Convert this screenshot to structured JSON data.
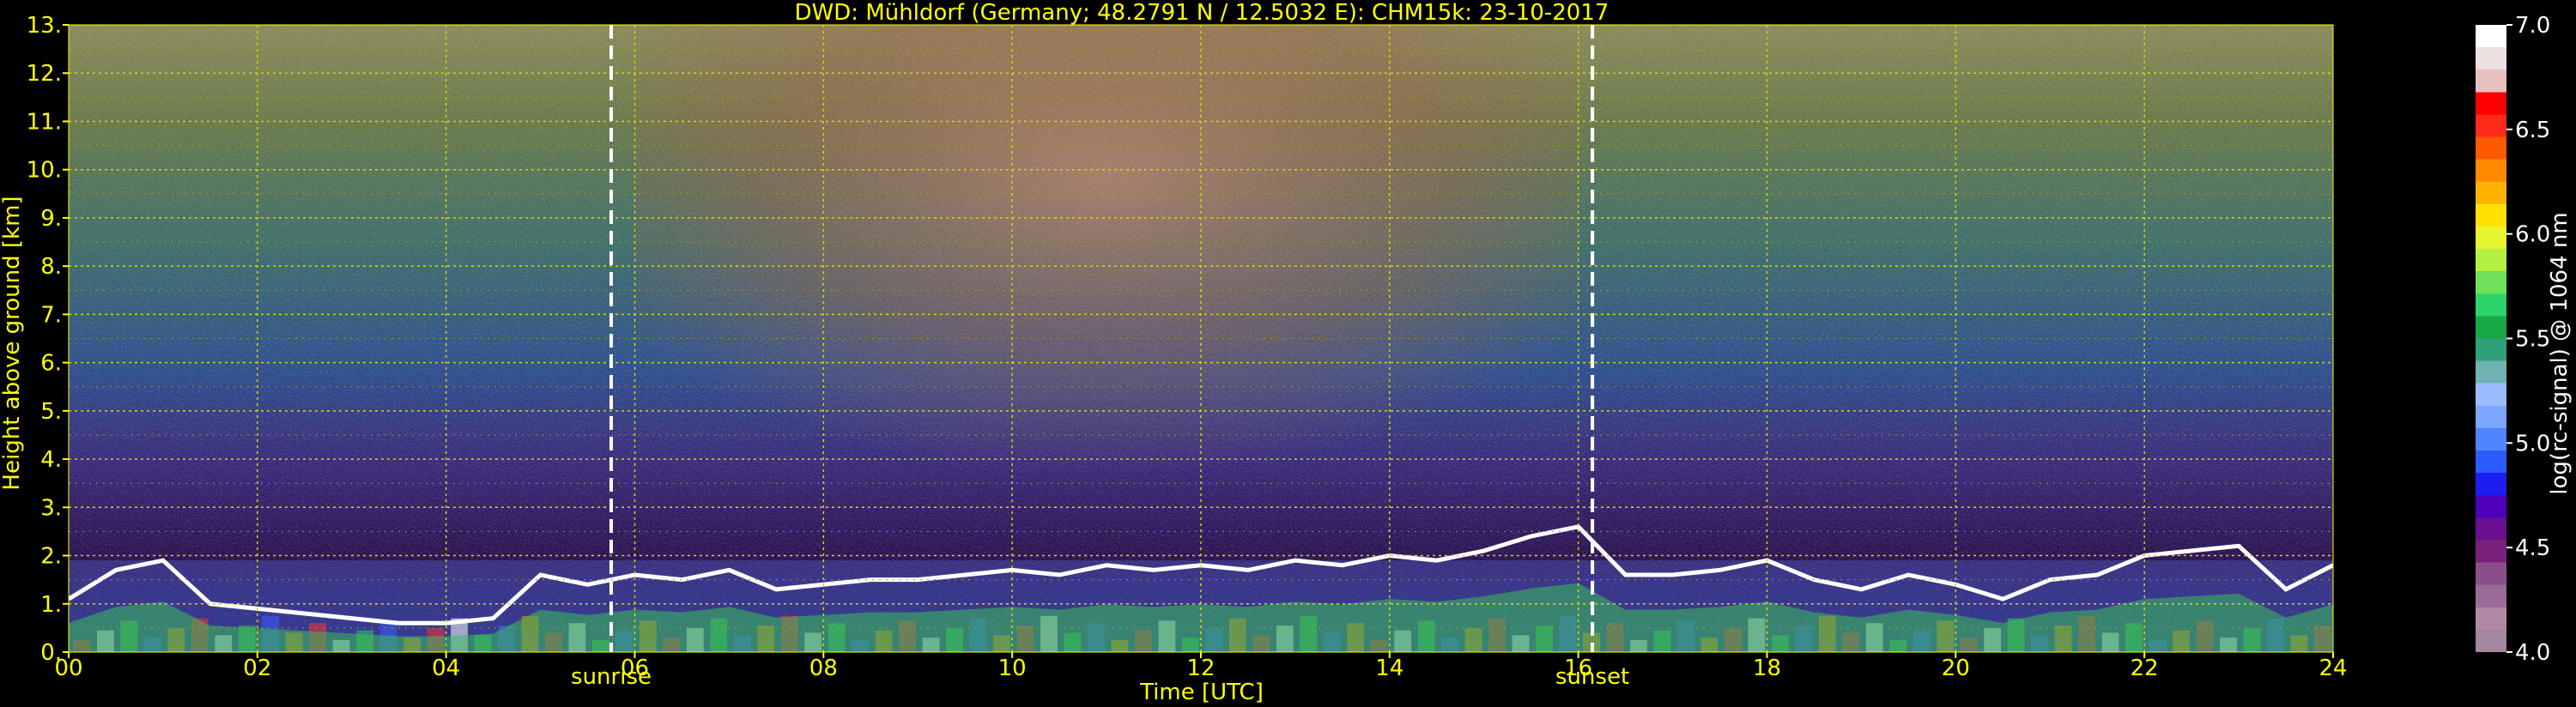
{
  "chart_data": {
    "type": "heatmap",
    "title": "DWD: Mühldorf (Germany; 48.2791 N / 12.5032 E):    CHM15k: 23-10-2017",
    "xlabel": "Time [UTC]",
    "ylabel": "Height above ground [km]",
    "xlim": [
      0,
      24
    ],
    "ylim": [
      0,
      13
    ],
    "x_ticks": [
      "00",
      "02",
      "04",
      "06",
      "08",
      "10",
      "12",
      "14",
      "16",
      "18",
      "20",
      "22",
      "24"
    ],
    "y_ticks": [
      "0.",
      "1.",
      "2.",
      "3.",
      "4.",
      "5.",
      "6.",
      "7.",
      "8.",
      "9.",
      "10.",
      "11.",
      "12.",
      "13."
    ],
    "grid": true,
    "colorbar": {
      "label": "log(rc-signal) @ 1064 nm",
      "range": [
        4.0,
        7.0
      ],
      "ticks": [
        "4.0",
        "4.5",
        "5.0",
        "5.5",
        "6.0",
        "6.5",
        "7.0"
      ],
      "colors": [
        "#a3879c",
        "#b089a6",
        "#9b6b97",
        "#8a4f8a",
        "#7a1f7a",
        "#6a0f8f",
        "#4d00b8",
        "#1c1cf0",
        "#2b5cff",
        "#4f86ff",
        "#7aa6ff",
        "#9bbcff",
        "#6fb3b3",
        "#2ea07a",
        "#17a845",
        "#2bd36a",
        "#6ee05a",
        "#b4f040",
        "#e6f530",
        "#ffe000",
        "#ffb300",
        "#ff8a00",
        "#ff5a00",
        "#ff2a1a",
        "#ff0000",
        "#e8c0c0",
        "#ece0e0",
        "#ffffff"
      ]
    },
    "markers": [
      {
        "label": "sunrise",
        "x": 5.75
      },
      {
        "label": "sunset",
        "x": 16.15
      }
    ],
    "cloud_top_km": [
      [
        0.0,
        1.1
      ],
      [
        0.5,
        1.7
      ],
      [
        1.0,
        1.9
      ],
      [
        1.5,
        1.0
      ],
      [
        2.0,
        0.9
      ],
      [
        2.5,
        0.8
      ],
      [
        3.0,
        0.7
      ],
      [
        3.5,
        0.6
      ],
      [
        4.0,
        0.6
      ],
      [
        4.5,
        0.7
      ],
      [
        5.0,
        1.6
      ],
      [
        5.5,
        1.4
      ],
      [
        6.0,
        1.6
      ],
      [
        6.5,
        1.5
      ],
      [
        7.0,
        1.7
      ],
      [
        7.5,
        1.3
      ],
      [
        8.0,
        1.4
      ],
      [
        8.5,
        1.5
      ],
      [
        9.0,
        1.5
      ],
      [
        9.5,
        1.6
      ],
      [
        10.0,
        1.7
      ],
      [
        10.5,
        1.6
      ],
      [
        11.0,
        1.8
      ],
      [
        11.5,
        1.7
      ],
      [
        12.0,
        1.8
      ],
      [
        12.5,
        1.7
      ],
      [
        13.0,
        1.9
      ],
      [
        13.5,
        1.8
      ],
      [
        14.0,
        2.0
      ],
      [
        14.5,
        1.9
      ],
      [
        15.0,
        2.1
      ],
      [
        15.5,
        2.4
      ],
      [
        16.0,
        2.6
      ],
      [
        16.5,
        1.6
      ],
      [
        17.0,
        1.6
      ],
      [
        17.5,
        1.7
      ],
      [
        18.0,
        1.9
      ],
      [
        18.5,
        1.5
      ],
      [
        19.0,
        1.3
      ],
      [
        19.5,
        1.6
      ],
      [
        20.0,
        1.4
      ],
      [
        20.5,
        1.1
      ],
      [
        21.0,
        1.5
      ],
      [
        21.5,
        1.6
      ],
      [
        22.0,
        2.0
      ],
      [
        22.5,
        2.1
      ],
      [
        23.0,
        2.2
      ],
      [
        23.5,
        1.3
      ],
      [
        24.0,
        1.8
      ]
    ]
  }
}
